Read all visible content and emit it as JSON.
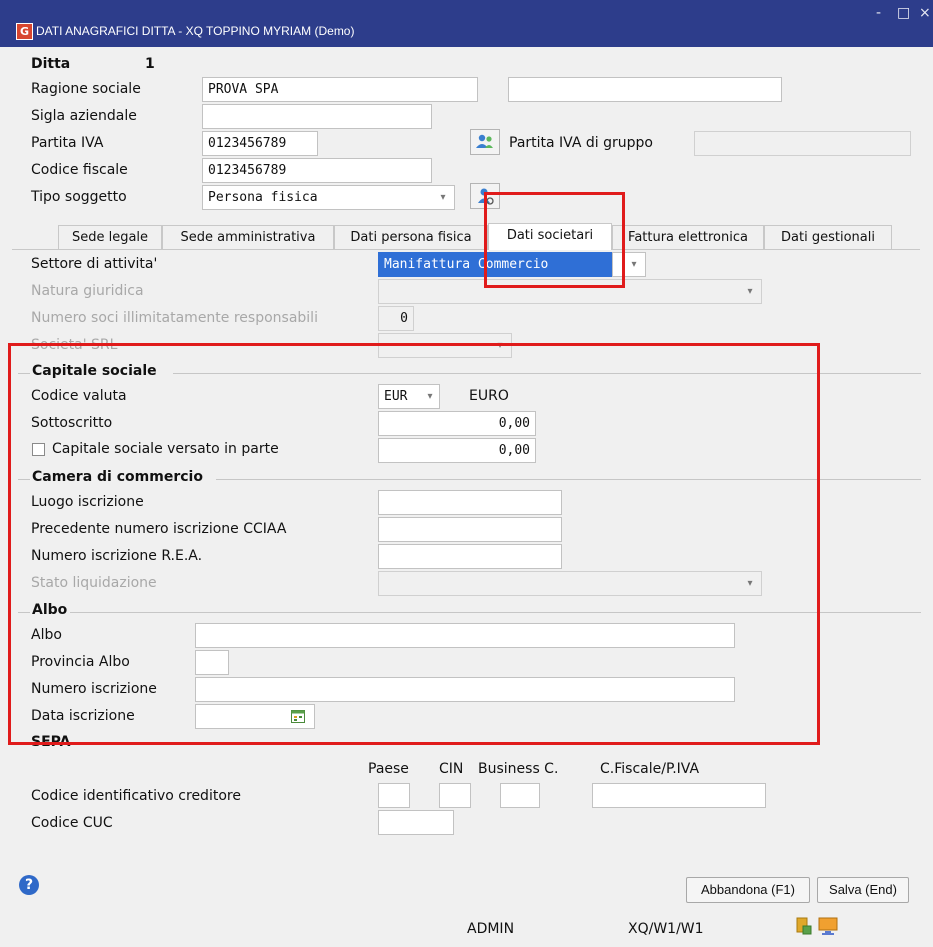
{
  "window": {
    "title": "DATI ANAGRAFICI DITTA - XQ TOPPINO MYRIAM  (Demo)",
    "app_icon_letter": "G",
    "minimize": "-",
    "maximize": "□",
    "close": "×"
  },
  "header": {
    "ditta_label": "Ditta",
    "ditta_value": "1",
    "ragione_sociale_label": "Ragione sociale",
    "ragione_sociale_value": "PROVA SPA",
    "ragione_sociale_extra": "",
    "sigla_label": "Sigla aziendale",
    "sigla_value": "",
    "partita_iva_label": "Partita IVA",
    "partita_iva_value": "0123456789",
    "partita_iva_gruppo_label": "Partita IVA di gruppo",
    "partita_iva_gruppo_value": "",
    "codice_fiscale_label": "Codice fiscale",
    "codice_fiscale_value": "0123456789",
    "tipo_soggetto_label": "Tipo soggetto",
    "tipo_soggetto_value": "Persona fisica"
  },
  "tabs": [
    {
      "label": "Sede legale"
    },
    {
      "label": "Sede amministrativa"
    },
    {
      "label": "Dati persona fisica"
    },
    {
      "label": "Dati societari"
    },
    {
      "label": "Fattura elettronica"
    },
    {
      "label": "Dati gestionali"
    }
  ],
  "active_tab": "Dati societari",
  "societari": {
    "settore_label": "Settore di attivita'",
    "settore_value": "Manifattura Commercio",
    "natura_label": "Natura giuridica",
    "natura_value": "",
    "numero_soci_label": "Numero soci illimitatamente responsabili",
    "numero_soci_value": "0",
    "societa_srl_label": "Societa' SRL",
    "societa_srl_value": ""
  },
  "capitale": {
    "section_title": "Capitale sociale",
    "codice_valuta_label": "Codice valuta",
    "codice_valuta_value": "EUR",
    "valuta_name": "EURO",
    "sottoscritto_label": "Sottoscritto",
    "sottoscritto_value": "0,00",
    "versato_label": "Capitale sociale versato in parte",
    "versato_value": "0,00"
  },
  "camera": {
    "section_title": "Camera di commercio",
    "luogo_label": "Luogo iscrizione",
    "luogo_value": "",
    "precedente_label": "Precedente numero iscrizione CCIAA",
    "precedente_value": "",
    "rea_label": "Numero iscrizione R.E.A.",
    "rea_value": "",
    "stato_label": "Stato liquidazione",
    "stato_value": ""
  },
  "albo": {
    "section_title": "Albo",
    "albo_label": "Albo",
    "albo_value": "",
    "provincia_label": "Provincia Albo",
    "provincia_value": "",
    "numero_label": "Numero iscrizione",
    "numero_value": "",
    "data_label": "Data iscrizione",
    "data_value": ""
  },
  "sepa": {
    "section_title": "SEPA",
    "col_paese": "Paese",
    "col_cin": "CIN",
    "col_business": "Business C.",
    "col_cf": "C.Fiscale/P.IVA",
    "creditore_label": "Codice identificativo creditore",
    "cuc_label": "Codice CUC",
    "paese_value": "",
    "cin_value": "",
    "business_value": "",
    "cf_value": "",
    "cuc_value": ""
  },
  "footer": {
    "abbandona_label": "Abbandona (F1)",
    "salva_label": "Salva (End)",
    "user": "ADMIN",
    "path": "XQ/W1/W1",
    "help_symbol": "?"
  },
  "colors": {
    "titlebar": "#2d3d8b",
    "highlight_box": "#e01b1b",
    "selection": "#2f6fd6"
  }
}
